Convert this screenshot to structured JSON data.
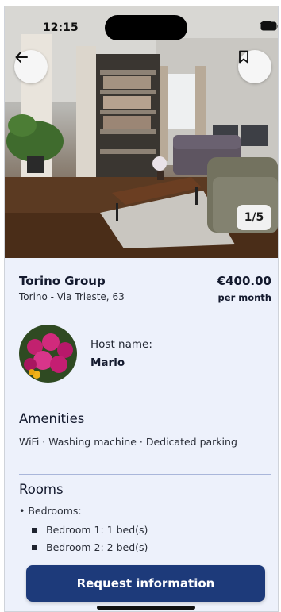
{
  "status_bar": {
    "time": "12:15"
  },
  "gallery": {
    "counter": "1/5"
  },
  "listing": {
    "title": "Torino Group",
    "address": "Torino - Via Trieste, 63",
    "price": "€400.00",
    "period": "per month"
  },
  "host": {
    "label": "Host name:",
    "name": "Mario"
  },
  "amenities": {
    "heading": "Amenities",
    "text": "WiFi · Washing machine · Dedicated parking"
  },
  "rooms": {
    "heading": "Rooms",
    "bedrooms_label": "• Bedrooms:",
    "items": [
      "Bedroom 1: 1 bed(s)",
      "Bedroom 2: 2 bed(s)"
    ]
  },
  "cta": {
    "label": "Request information"
  },
  "colors": {
    "primary": "#1d3a7a",
    "background": "#edf1fb",
    "divider": "#a9b6da"
  },
  "icons": {
    "back": "arrow-left-icon",
    "bookmark": "bookmark-icon"
  }
}
